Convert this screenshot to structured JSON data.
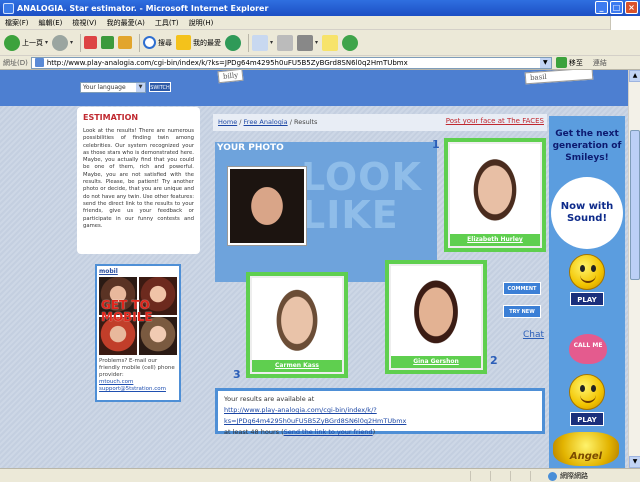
{
  "window": {
    "title": "ANALOGIA. Star estimator. - Microsoft Internet Explorer",
    "controls": [
      "_",
      "□",
      "×"
    ]
  },
  "menu": [
    "檔案(F)",
    "編輯(E)",
    "檢視(V)",
    "我的最愛(A)",
    "工具(T)",
    "說明(H)"
  ],
  "toolbar": {
    "back_label": "上一頁",
    "search_label": "搜尋",
    "favorites_label": "我的最愛"
  },
  "address": {
    "label": "網址(D)",
    "url": "http://www.play-analogia.com/cgi-bin/index/k/?ks=JPDg64m4295h0uFU5B5ZyBGrd8SN6l0q2HmTUbmx",
    "go_label": "移至",
    "links_label": "連結"
  },
  "header": {
    "scribble_left": "billy",
    "scribble_right": "basil",
    "language_placeholder": "Your language",
    "switch_label": "SWITCH"
  },
  "estimation": {
    "title": "ESTIMATION",
    "text": "Look at the results! There are numerous possibilities of finding twin among celebrities. Our system recognized your as those stars who is demonstrated here. Maybe, you actually find that you could be one of them, rich and powerful. Maybe, you are not satisfied with the results. Please, be patient! Try another photo or decide, that you are unique and do not have any twin. Use other features: send the direct link to the results to your friends, give us your feedback or participate in our funny contests and games."
  },
  "mobile": {
    "title": "mobil",
    "overlay": "GET TO MOBILE",
    "text": "Problems? E-mail our friendly mobile (cell) phone provider:",
    "link1": "mtouch.com",
    "link2": "support@5tstration.com"
  },
  "breadcrumb": {
    "home": "Home",
    "sep": " / ",
    "free": "Free Analogia",
    "current": "Results"
  },
  "post_link": "Post your face at The FACES",
  "photo_panel": {
    "title": "YOUR PHOTO",
    "big_word_1": "LOOK",
    "big_word_2": "LIKE"
  },
  "matches": [
    {
      "rank": "1",
      "name": "Elizabeth Hurley"
    },
    {
      "rank": "2",
      "name": "Gina Gershon"
    },
    {
      "rank": "3",
      "name": "Carmen Kass"
    }
  ],
  "buttons": {
    "comment": "COMMENT",
    "try_new": "TRY NEW",
    "chat": "Chat"
  },
  "results": {
    "line1": "Your results are available at",
    "url": "http://www.play-analogia.com/cgi-bin/index/k/?ks=JPDg64m4295h0uFU5B5ZyBGrd8SN6l0q2HmTUbmx",
    "line3_prefix": "at least 48 hours (",
    "line3_link": "Send the link to your friend",
    "line3_suffix": ")"
  },
  "ad": {
    "title": "Get the next generation of Smileys!",
    "burst": "Now with Sound!",
    "play": "PLAY",
    "call_me": "CALL ME",
    "angel": "Angel"
  },
  "status": {
    "zone": "網際網路"
  }
}
